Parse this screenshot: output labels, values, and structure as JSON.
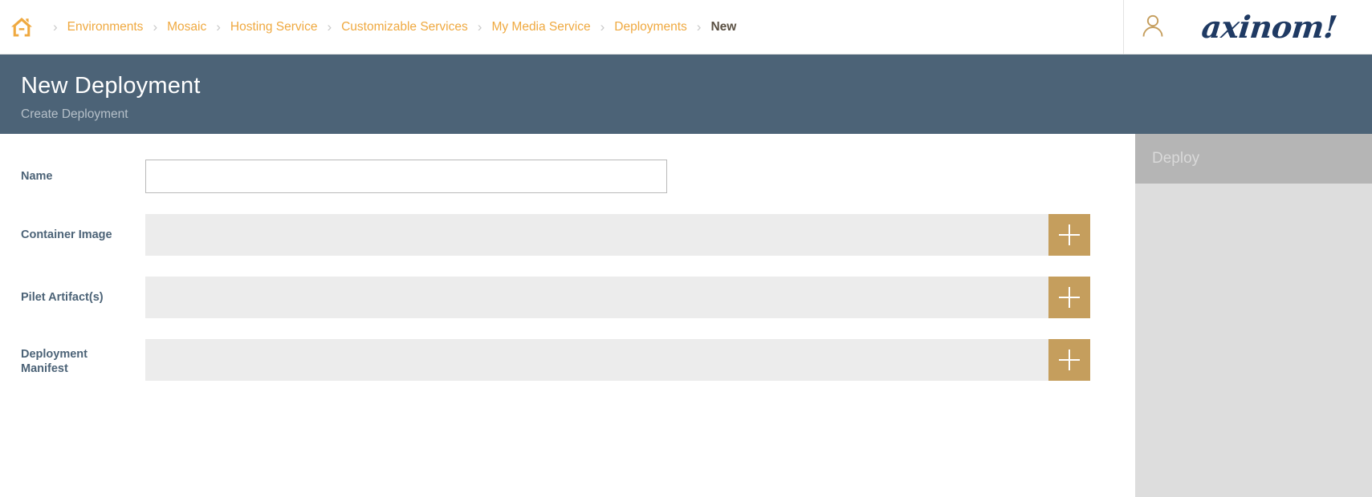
{
  "topbar": {
    "home_icon": "home-icon",
    "breadcrumb": [
      {
        "label": "Environments",
        "current": false
      },
      {
        "label": "Mosaic",
        "current": false
      },
      {
        "label": "Hosting Service",
        "current": false
      },
      {
        "label": "Customizable Services",
        "current": false
      },
      {
        "label": "My Media Service",
        "current": false
      },
      {
        "label": "Deployments",
        "current": false
      },
      {
        "label": "New",
        "current": true
      }
    ],
    "separator": "›",
    "user_icon": "user-account-icon",
    "brand": "axinom!"
  },
  "page_header": {
    "title": "New Deployment",
    "subtitle": "Create Deployment"
  },
  "form": {
    "name": {
      "label": "Name",
      "value": "",
      "placeholder": ""
    },
    "container_image": {
      "label": "Container Image",
      "value": "",
      "add_icon": "plus-icon"
    },
    "pilet_artifacts": {
      "label": "Pilet Artifact(s)",
      "value": "",
      "add_icon": "plus-icon"
    },
    "deployment_manifest": {
      "label": "Deployment Manifest",
      "value": "",
      "add_icon": "plus-icon"
    }
  },
  "sidebar": {
    "deploy_label": "Deploy"
  },
  "colors": {
    "accent_orange": "#efa940",
    "accent_gold": "#c59e5d",
    "header_slate": "#4c6377",
    "brand_navy": "#1f3a63",
    "field_gray": "#ececec",
    "sidebar_gray": "#dddddd",
    "disabled_button": "#b5b5b5"
  }
}
